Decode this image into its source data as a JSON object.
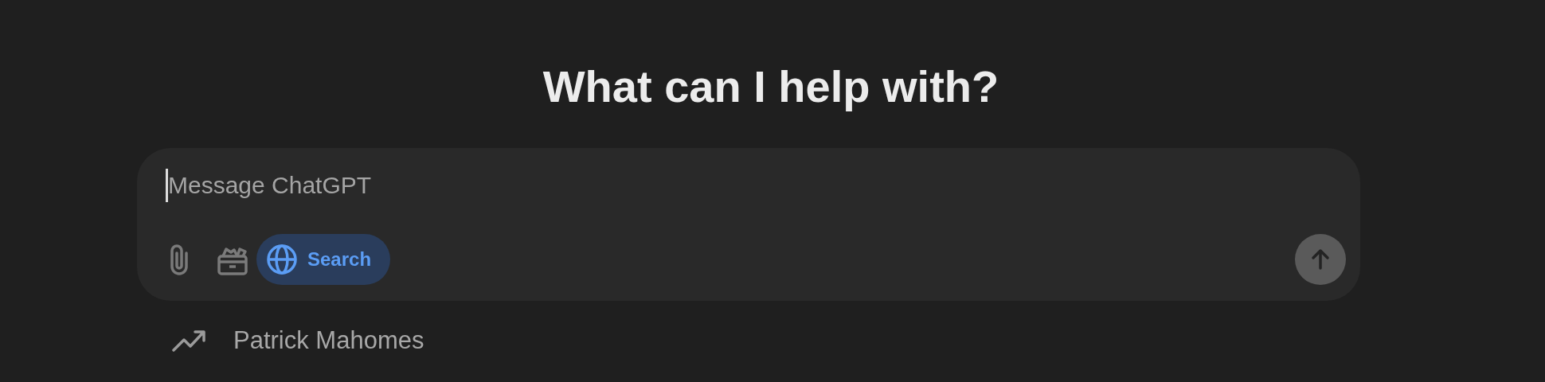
{
  "heading": "What can I help with?",
  "composer": {
    "placeholder": "Message ChatGPT",
    "search": {
      "label": "Search",
      "selected": true
    },
    "send_disabled": true
  },
  "suggestions": [
    {
      "label": "Patrick Mahomes"
    }
  ]
}
